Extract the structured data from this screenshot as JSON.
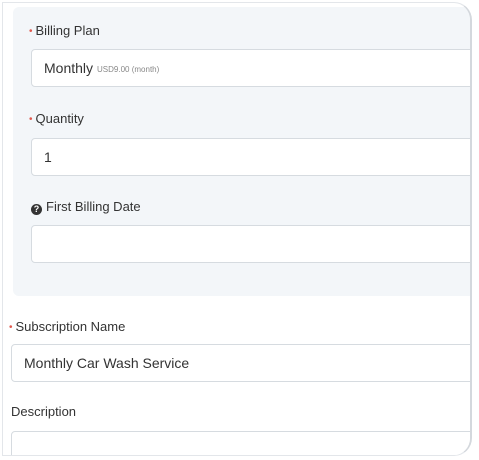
{
  "form": {
    "billing_plan": {
      "label": "Billing Plan",
      "value": "Monthly",
      "sub": "USD9.00 (month)"
    },
    "quantity": {
      "label": "Quantity",
      "value": "1"
    },
    "first_billing_date": {
      "label": "First Billing Date",
      "value": ""
    },
    "subscription_name": {
      "label": "Subscription Name",
      "value": "Monthly Car Wash Service"
    },
    "description": {
      "label": "Description",
      "value": ""
    }
  },
  "colors": {
    "required": "#e05a4f",
    "panel": "#f3f6f9",
    "border": "#d6dbe0"
  }
}
